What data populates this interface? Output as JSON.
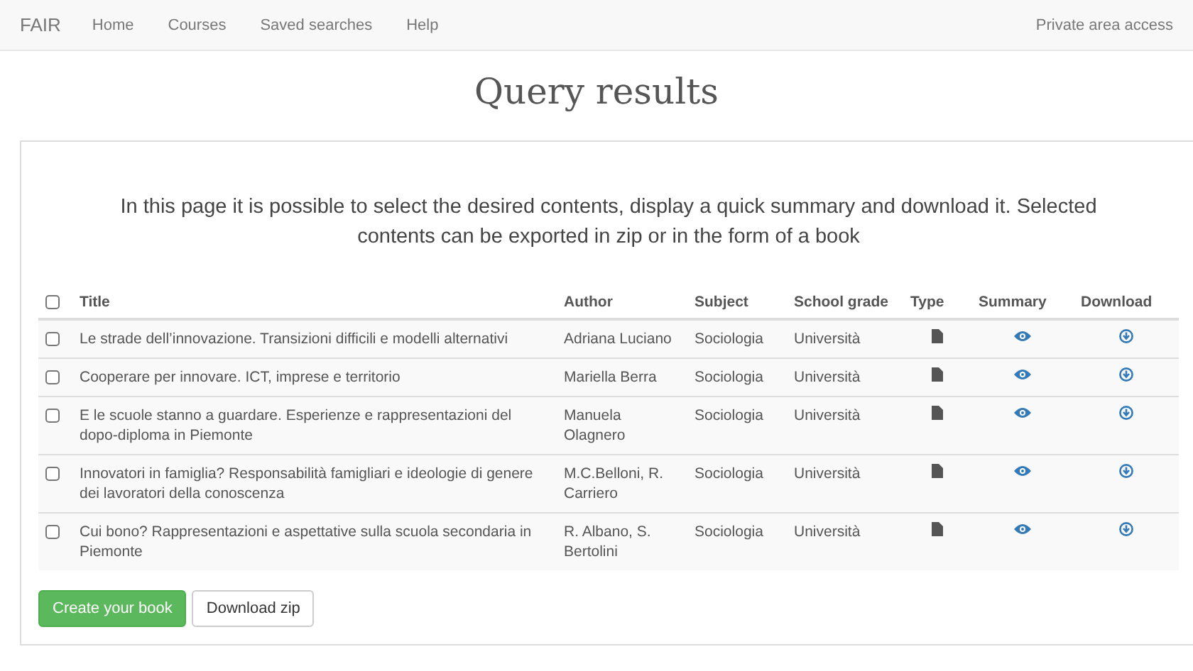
{
  "navbar": {
    "brand": "FAIR",
    "links": [
      "Home",
      "Courses",
      "Saved searches",
      "Help"
    ],
    "right_link": "Private area access"
  },
  "title": "Query results",
  "intro": "In this page it is possible to select the desired contents, display a quick summary and download it. Selected contents can be exported in zip or in the form of a book",
  "table": {
    "select_all": {
      "checked": false
    },
    "columns": [
      "Title",
      "Author",
      "Subject",
      "School grade",
      "Type",
      "Summary",
      "Download"
    ],
    "rows": [
      {
        "checked": false,
        "title": "Le strade dell’innovazione. Transizioni difficili e modelli alternativi",
        "author": "Adriana Luciano",
        "subject": "Sociologia",
        "grade": "Università"
      },
      {
        "checked": false,
        "title": "Cooperare per innovare. ICT, imprese e territorio",
        "author": "Mariella Berra",
        "subject": "Sociologia",
        "grade": "Università"
      },
      {
        "checked": false,
        "title": "E le scuole stanno a guardare. Esperienze e rappresentazioni del dopo-diploma in Piemonte",
        "author": "Manuela Olagnero",
        "subject": "Sociologia",
        "grade": "Università"
      },
      {
        "checked": false,
        "title": "Innovatori in famiglia? Responsabilità famigliari e ideologie di genere dei lavoratori della conoscenza",
        "author": "M.C.Belloni, R. Carriero",
        "subject": "Sociologia",
        "grade": "Università"
      },
      {
        "checked": false,
        "title": "Cui bono? Rappresentazioni e aspettative sulla scuola secondaria in Piemonte",
        "author": "R. Albano, S. Bertolini",
        "subject": "Sociologia",
        "grade": "Università"
      }
    ]
  },
  "buttons": [
    {
      "kind": "primary",
      "label": "Create your book"
    },
    {
      "kind": "default",
      "label": "Download zip"
    }
  ]
}
